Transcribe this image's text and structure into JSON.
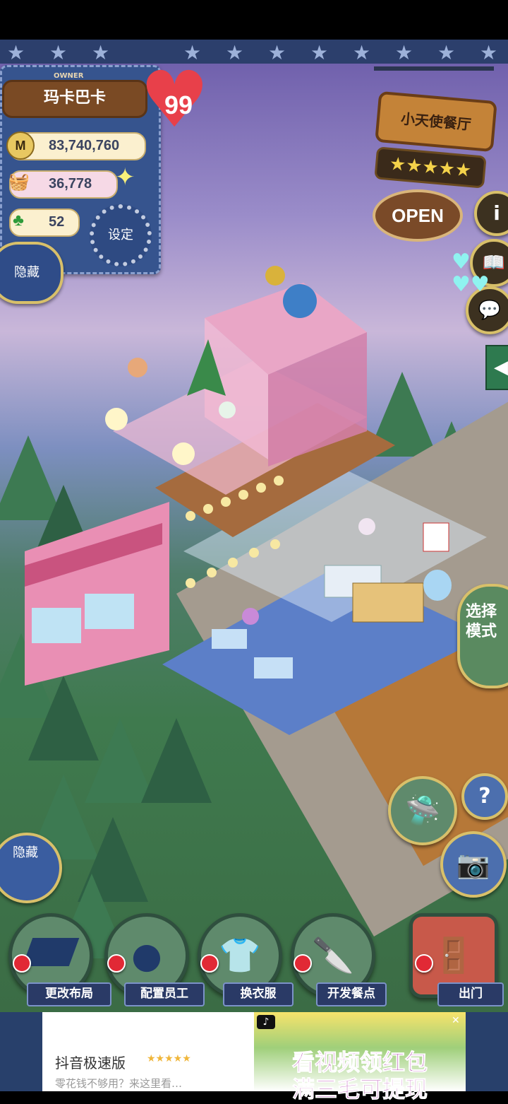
{
  "owner_panel": {
    "owner_tag": "OWNER",
    "owner_name": "玛卡巴卡",
    "level": "99",
    "money": "83,740,760",
    "ingredients": "36,778",
    "clover": "52",
    "settings_label": "设定",
    "hide_label": "隐藏"
  },
  "restaurant_sign": {
    "name": "小天使餐厅",
    "stars": 5,
    "status": "OPEN"
  },
  "right_side": {
    "info_icon": "i",
    "mode_label": "选择模式"
  },
  "left_side": {
    "hide_label": "隐藏"
  },
  "right_buttons": {
    "help_label": "?"
  },
  "bottom_bar": [
    {
      "id": "change-layout",
      "label": "更改布局"
    },
    {
      "id": "assign-staff",
      "label": "配置员工"
    },
    {
      "id": "change-clothes",
      "label": "换衣服"
    },
    {
      "id": "develop-dishes",
      "label": "开发餐点"
    },
    {
      "id": "exit",
      "label": "出门"
    }
  ],
  "ad": {
    "app_name": "抖音极速版",
    "tagline": "零花钱不够用？来这里看…",
    "banner_line1": "看视频领红包",
    "banner_line2": "满三毛可提现",
    "close_label": "✕"
  },
  "colors": {
    "panel_blue": "#36548e",
    "wood": "#c48338",
    "heart_red": "#e8404a",
    "pink_building": "#e98fb4"
  }
}
